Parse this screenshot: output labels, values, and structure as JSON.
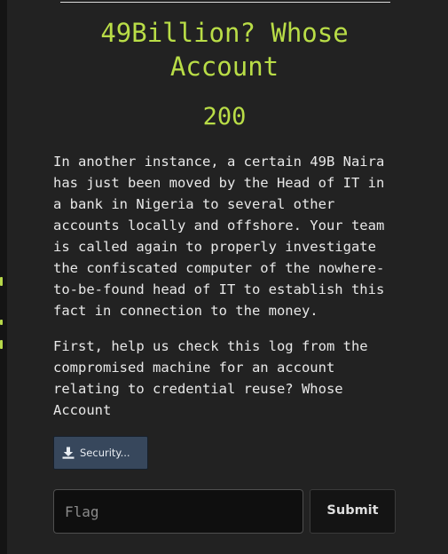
{
  "challenge": {
    "title": "49Billion? Whose Account",
    "points": "200",
    "description_lines": [
      "In another instance, a certain 49B Naira",
      "has just been moved by the Head of IT in",
      "a bank in Nigeria to several other",
      "accounts locally and offshore. Your team",
      "is called again to properly investigate",
      "the confiscated computer of the nowhere-",
      "to-be-found head of IT to establish this",
      "fact in connection to the money."
    ],
    "question_lines": [
      "First, help us check this log from the",
      "compromised machine for an account",
      "relating to credential reuse? Whose",
      "Account"
    ]
  },
  "file": {
    "label": "Security...",
    "icon": "download-icon"
  },
  "submission": {
    "placeholder": "Flag",
    "value": "",
    "submit_label": "Submit"
  },
  "colors": {
    "accent": "#b9dd47",
    "modal_background": "#222222",
    "file_button": "#37475c"
  }
}
